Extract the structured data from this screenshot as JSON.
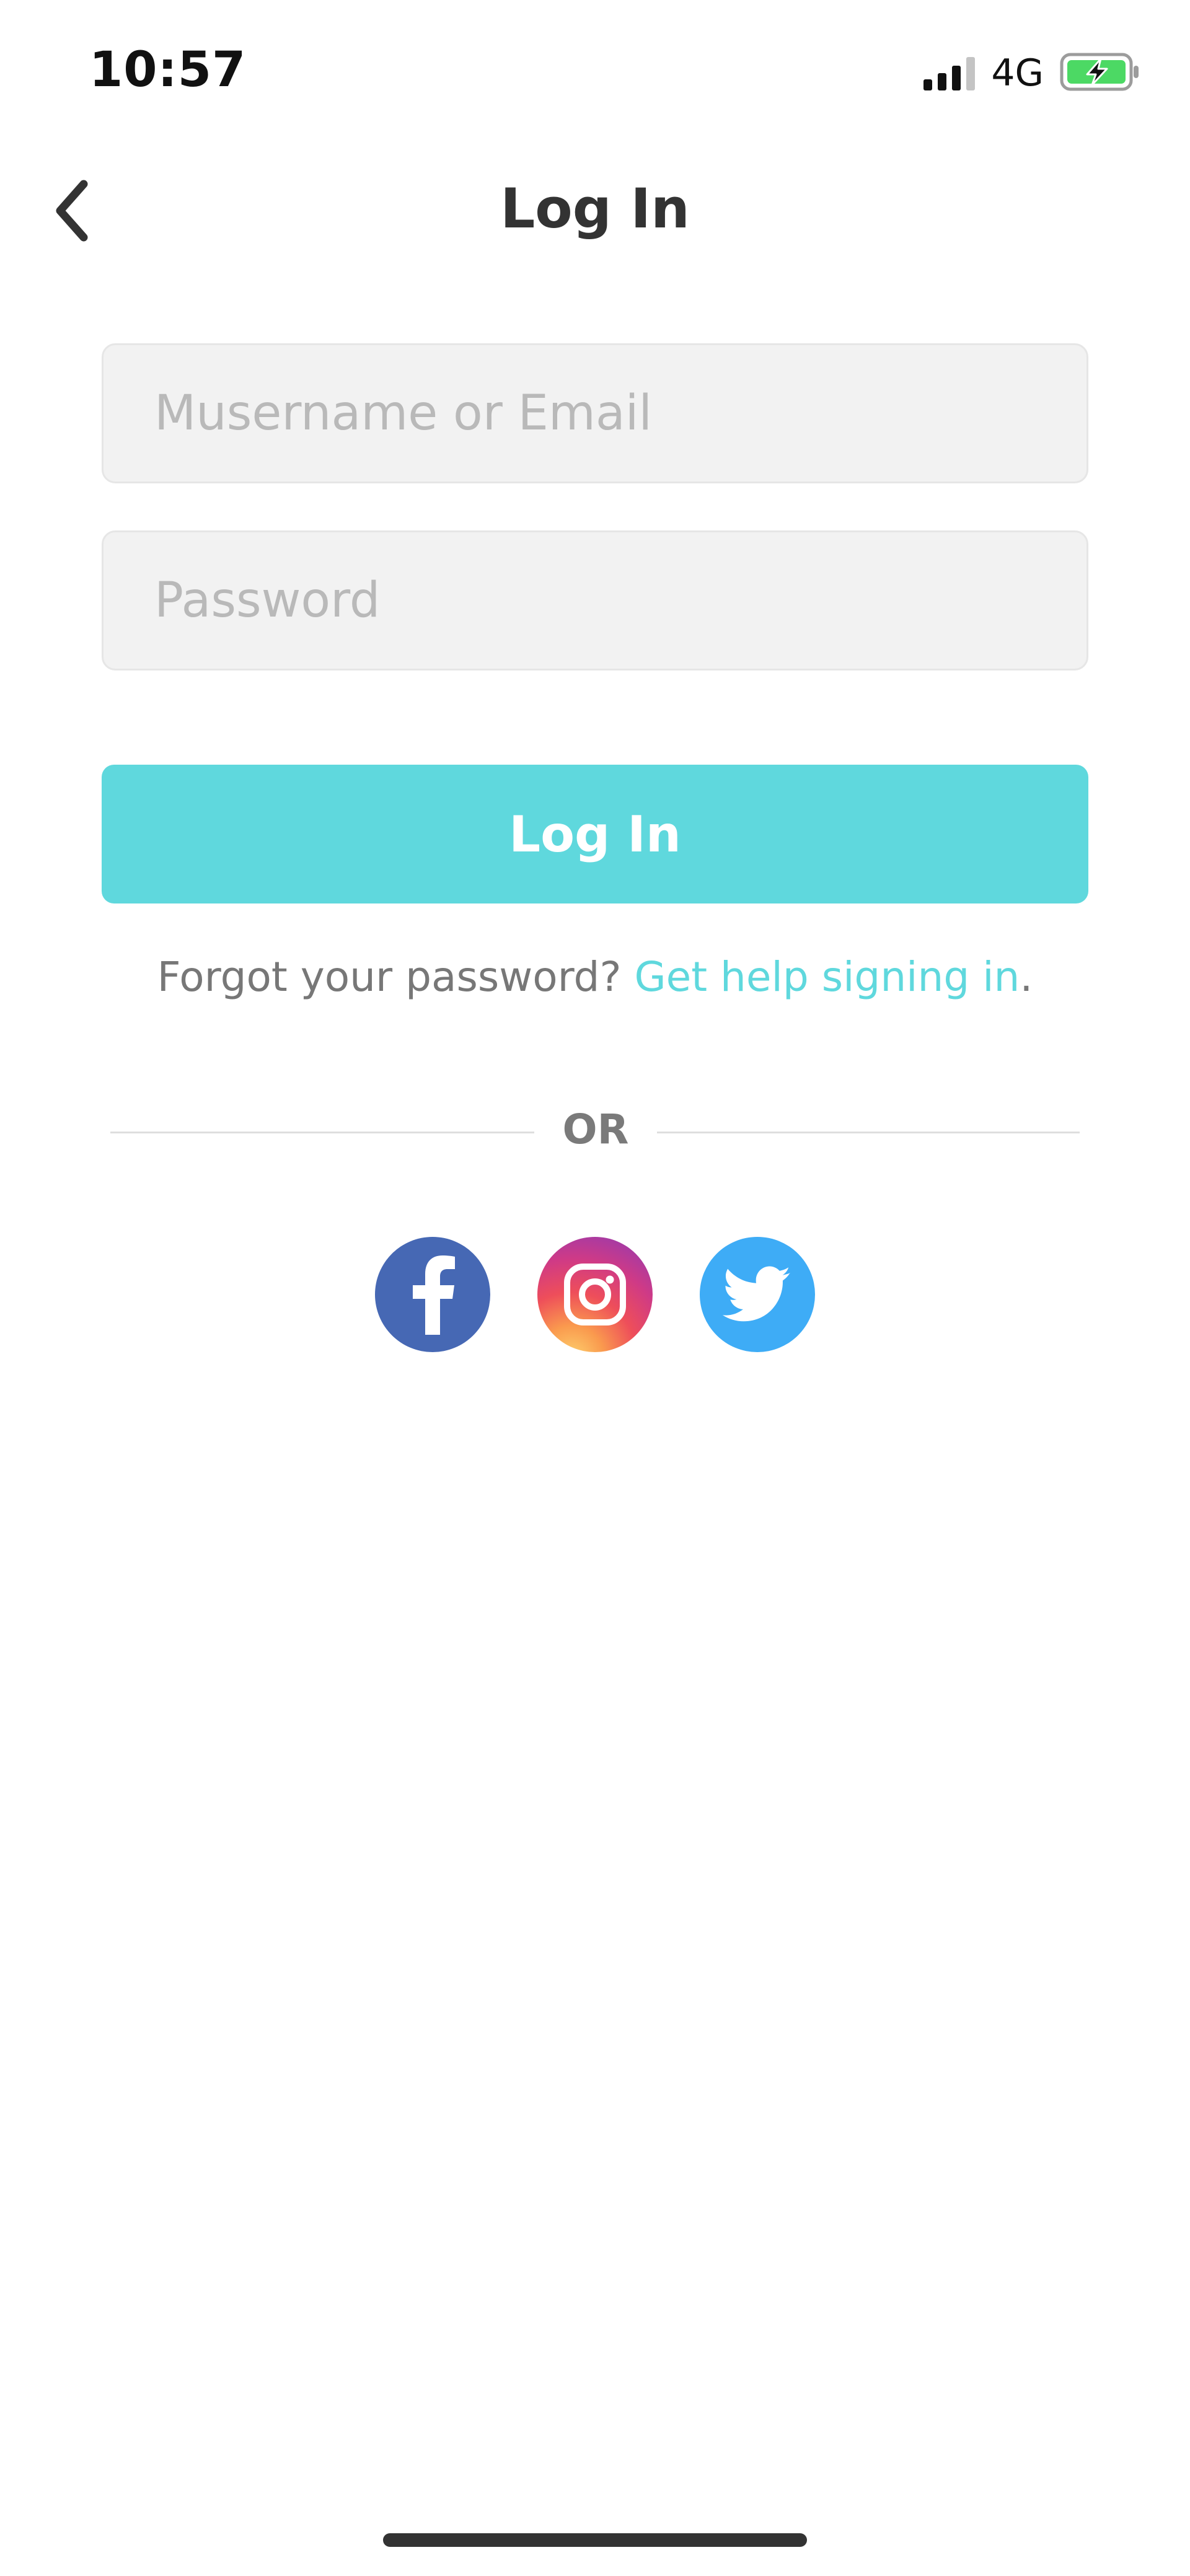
{
  "status_bar": {
    "time": "10:57",
    "network": "4G",
    "battery_icon": "battery-charging-icon",
    "signal_icon": "cellular-signal-icon"
  },
  "header": {
    "title": "Log In",
    "back_icon": "chevron-left-icon"
  },
  "form": {
    "username": {
      "value": "",
      "placeholder": "Musername or Email"
    },
    "password": {
      "value": "",
      "placeholder": "Password"
    },
    "submit_label": "Log In"
  },
  "help": {
    "prefix": "Forgot your password? ",
    "link_text": "Get help signing in",
    "suffix": "."
  },
  "divider": {
    "text": "OR"
  },
  "social": [
    {
      "name": "facebook",
      "icon": "facebook-icon",
      "color": "#4668b4"
    },
    {
      "name": "instagram",
      "icon": "instagram-icon",
      "color": "#d63f78"
    },
    {
      "name": "twitter",
      "icon": "twitter-icon",
      "color": "#3eacf6"
    }
  ],
  "colors": {
    "accent": "#5fd8dd",
    "title": "#333333",
    "muted_text": "#777777",
    "field_background": "#f2f2f2",
    "battery_fill": "#4cd964"
  }
}
